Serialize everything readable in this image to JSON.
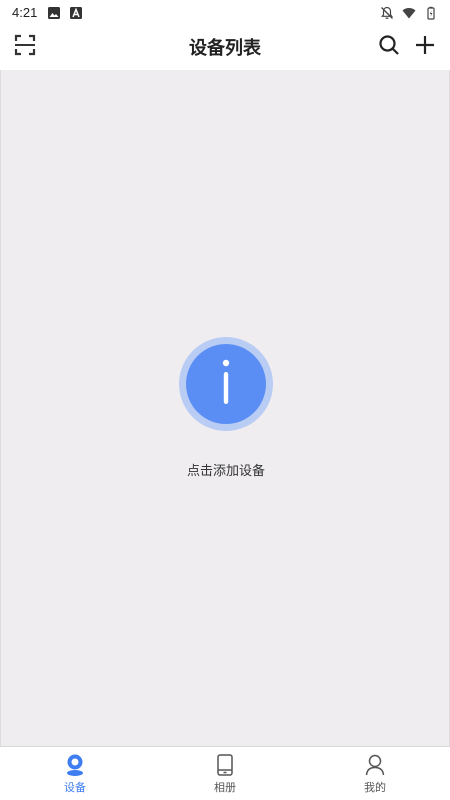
{
  "status_bar": {
    "time": "4:21",
    "left_icons": [
      "image-icon",
      "font-icon"
    ],
    "right_icons": [
      "notifications-off-icon",
      "wifi-icon",
      "battery-icon"
    ]
  },
  "app_bar": {
    "title": "设备列表",
    "left_icon": "scan-icon",
    "right_icons": [
      "search-icon",
      "add-icon"
    ]
  },
  "empty_state": {
    "icon": "info-icon",
    "message": "点击添加设备",
    "accent_color": "#5b8ef5"
  },
  "tabs": [
    {
      "label": "设备",
      "icon": "device-location-icon",
      "active": true
    },
    {
      "label": "相册",
      "icon": "phone-album-icon",
      "active": false
    },
    {
      "label": "我的",
      "icon": "user-icon",
      "active": false
    }
  ],
  "colors": {
    "accent": "#3f7ef0",
    "content_bg": "#efedf0"
  }
}
